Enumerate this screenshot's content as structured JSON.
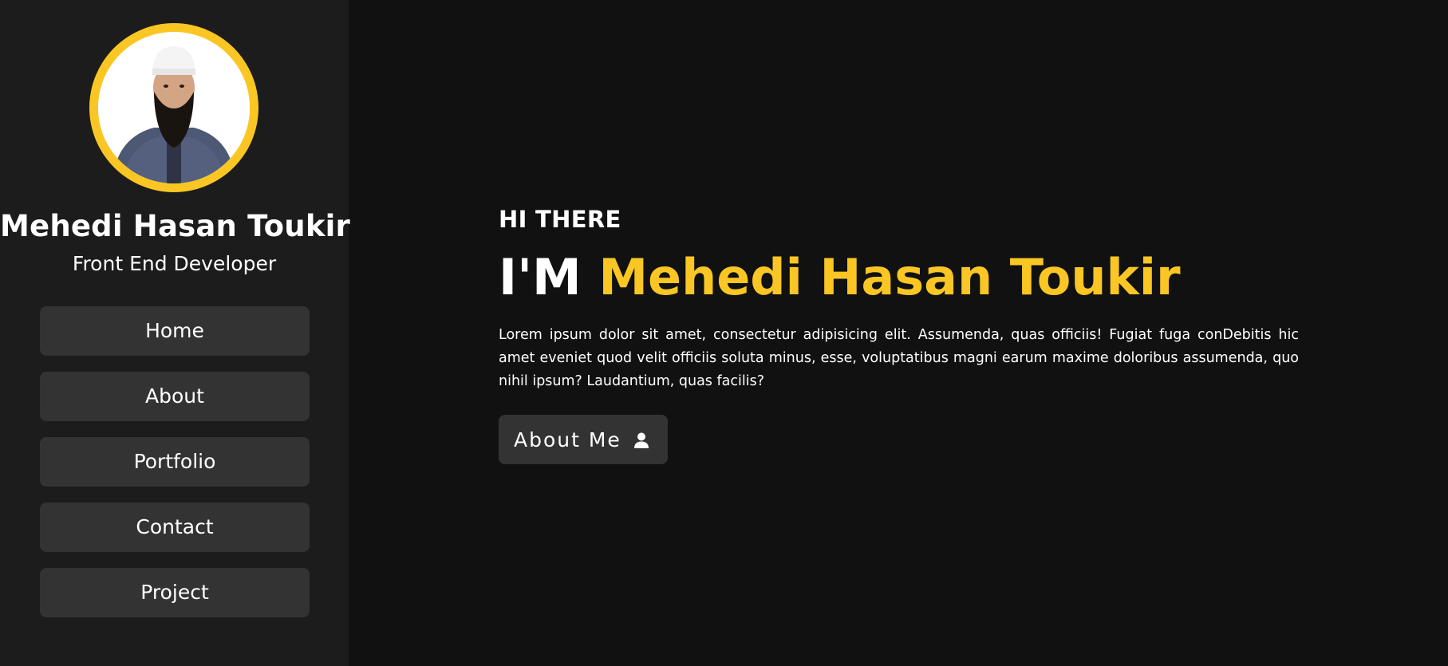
{
  "colors": {
    "accent": "#f9c624",
    "sidebar_bg": "#1c1c1c",
    "page_bg": "#111111",
    "button_bg": "#333333"
  },
  "sidebar": {
    "name": "Mehedi Hasan Toukir",
    "role": "Front End Developer",
    "nav": [
      {
        "label": "Home"
      },
      {
        "label": "About"
      },
      {
        "label": "Portfolio"
      },
      {
        "label": "Contact"
      },
      {
        "label": "Project"
      }
    ]
  },
  "hero": {
    "greeting": "HI THERE",
    "headline_prefix": "I'M",
    "headline_name": "Mehedi Hasan Toukir",
    "intro": "Lorem ipsum dolor sit amet, consectetur adipisicing elit. Assumenda, quas officiis! Fugiat fuga conDebitis hic amet eveniet quod velit officiis soluta minus, esse, voluptatibus magni earum maxime doloribus assumenda, quo nihil ipsum? Laudantium, quas facilis?",
    "cta_label": "About Me",
    "cta_icon": "user-icon"
  }
}
